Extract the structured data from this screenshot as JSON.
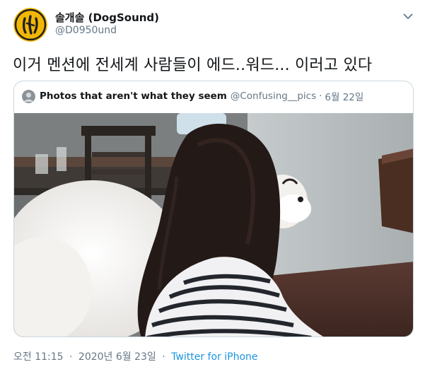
{
  "tweet": {
    "author": {
      "display_name": "솔개솔 (DogSound)",
      "handle": "@D0950und"
    },
    "text": "이거 멘션에 전세계 사람들이 에드..워드... 이러고 있다",
    "quoted": {
      "author_name": "Photos that aren't what they seem",
      "author_handle": "@Confusing__pics",
      "separator": "·",
      "date": "6월 22일"
    },
    "footer": {
      "time": "오전 11:15",
      "separator_1": "·",
      "date": "2020년 6월 23일",
      "separator_2": "·",
      "source": "Twitter for iPhone"
    }
  },
  "colors": {
    "primary_text": "#14171a",
    "secondary_text": "#657786",
    "link": "#1b95e0",
    "border": "#ccd6dd",
    "avatar_bg": "#f2b705"
  },
  "icons": {
    "menu": "chevron-down-icon"
  }
}
